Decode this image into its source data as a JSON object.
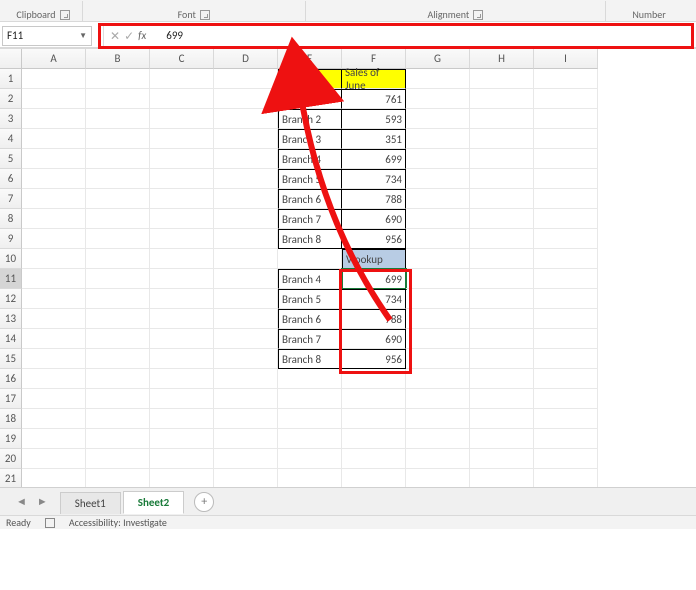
{
  "ribbon": {
    "clipboard": "Clipboard",
    "font": "Font",
    "alignment": "Alignment",
    "number": "Number"
  },
  "name_box": "F11",
  "formula_value": "699",
  "cols": [
    "A",
    "B",
    "C",
    "D",
    "E",
    "F",
    "G",
    "H",
    "I"
  ],
  "headers": {
    "branch": "BRANCH",
    "sales": "Sales of June"
  },
  "vlookup_label": "Vlookup",
  "tbl1": [
    {
      "b": "Branch 1",
      "v": 761
    },
    {
      "b": "Branch 2",
      "v": 593
    },
    {
      "b": "Branch 3",
      "v": 351
    },
    {
      "b": "Branch 4",
      "v": 699
    },
    {
      "b": "Branch 5",
      "v": 734
    },
    {
      "b": "Branch 6",
      "v": 788
    },
    {
      "b": "Branch 7",
      "v": 690
    },
    {
      "b": "Branch 8",
      "v": 956
    }
  ],
  "tbl2": [
    {
      "b": "Branch 4",
      "v": 699
    },
    {
      "b": "Branch 5",
      "v": 734
    },
    {
      "b": "Branch 6",
      "v": 788
    },
    {
      "b": "Branch 7",
      "v": 690
    },
    {
      "b": "Branch 8",
      "v": 956
    }
  ],
  "tabs": {
    "s1": "Sheet1",
    "s2": "Sheet2"
  },
  "status": {
    "ready": "Ready",
    "acc": "Accessibility: Investigate"
  }
}
